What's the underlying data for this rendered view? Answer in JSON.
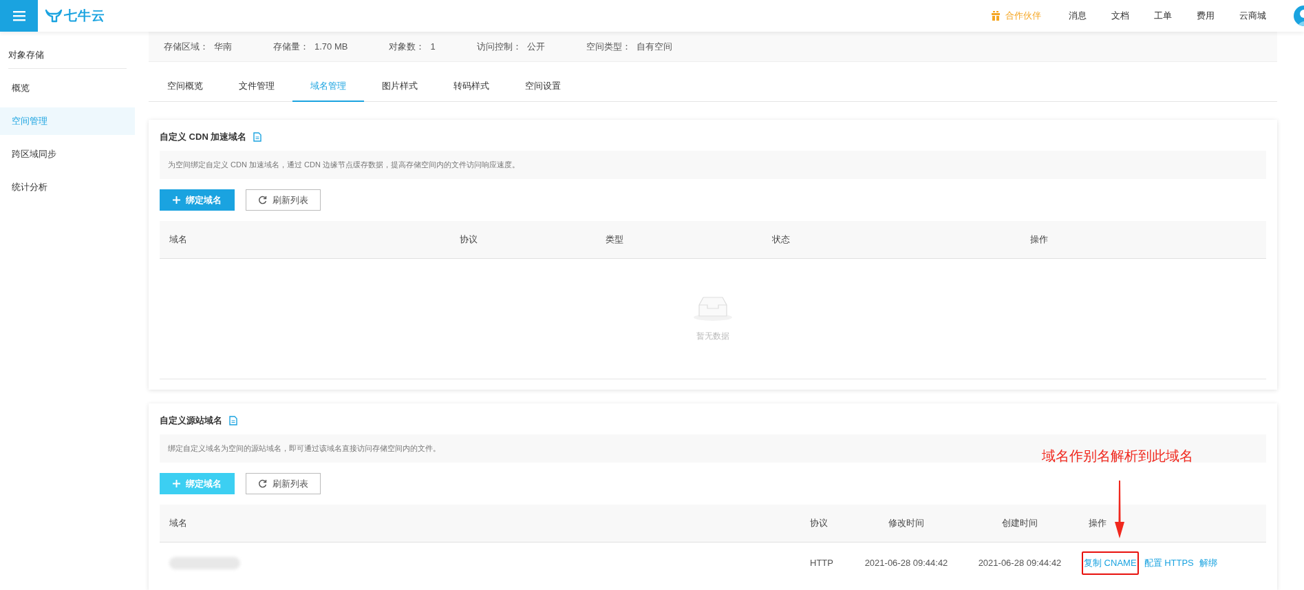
{
  "header": {
    "logo": "七牛云",
    "nav": [
      {
        "label": "合作伙伴",
        "kind": "promo"
      },
      {
        "label": "消息",
        "kind": "link"
      },
      {
        "label": "文档",
        "kind": "link"
      },
      {
        "label": "工单",
        "kind": "link"
      },
      {
        "label": "费用",
        "kind": "link"
      },
      {
        "label": "云商城",
        "kind": "link"
      }
    ]
  },
  "sidebar": {
    "title": "对象存储",
    "items": [
      {
        "label": "概览",
        "selected": false
      },
      {
        "label": "空间管理",
        "selected": true
      },
      {
        "label": "跨区域同步",
        "selected": false
      },
      {
        "label": "统计分析",
        "selected": false
      }
    ]
  },
  "info_bar": [
    {
      "label": "存储区域：",
      "value": "华南"
    },
    {
      "label": "存储量：",
      "value": "1.70 MB"
    },
    {
      "label": "对象数：",
      "value": "1"
    },
    {
      "label": "访问控制：",
      "value": "公开"
    },
    {
      "label": "空间类型：",
      "value": "自有空间"
    }
  ],
  "tabs": [
    {
      "label": "空间概览",
      "selected": false
    },
    {
      "label": "文件管理",
      "selected": false
    },
    {
      "label": "域名管理",
      "selected": true
    },
    {
      "label": "图片样式",
      "selected": false
    },
    {
      "label": "转码样式",
      "selected": false
    },
    {
      "label": "空间设置",
      "selected": false
    }
  ],
  "cards": [
    {
      "title": "自定义 CDN 加速域名",
      "description": "为空间绑定自定义 CDN 加速域名，通过 CDN 边缘节点缓存数据，提高存储空间内的文件访问响应速度。",
      "bind_button": {
        "label": "绑定域名",
        "disabled": false
      },
      "refresh_button": "刷新列表",
      "table": {
        "columns": [
          "域名",
          "协议",
          "类型",
          "状态",
          "操作"
        ],
        "empty_text": "暂无数据"
      }
    },
    {
      "title": "自定义源站域名",
      "description": "绑定自定义域名为空间的源站域名，即可通过该域名直接访问存储空间内的文件。",
      "bind_button": {
        "label": "绑定域名",
        "disabled": true
      },
      "refresh_button": "刷新列表",
      "table": {
        "columns": [
          "域名",
          "协议",
          "修改时间",
          "创建时间",
          "操作"
        ],
        "rows": [
          {
            "domain_redacted": true,
            "protocol": "HTTP",
            "modified": "2021-06-28 09:44:42",
            "created": "2021-06-28 09:44:42",
            "actions": [
              {
                "label": "复制 CNAME",
                "annotated": true
              },
              {
                "label": "配置 HTTPS",
                "annotated": false
              },
              {
                "label": "解绑",
                "annotated": false
              }
            ]
          }
        ]
      }
    }
  ],
  "annotation": {
    "text": "域名作别名解析到此域名"
  }
}
